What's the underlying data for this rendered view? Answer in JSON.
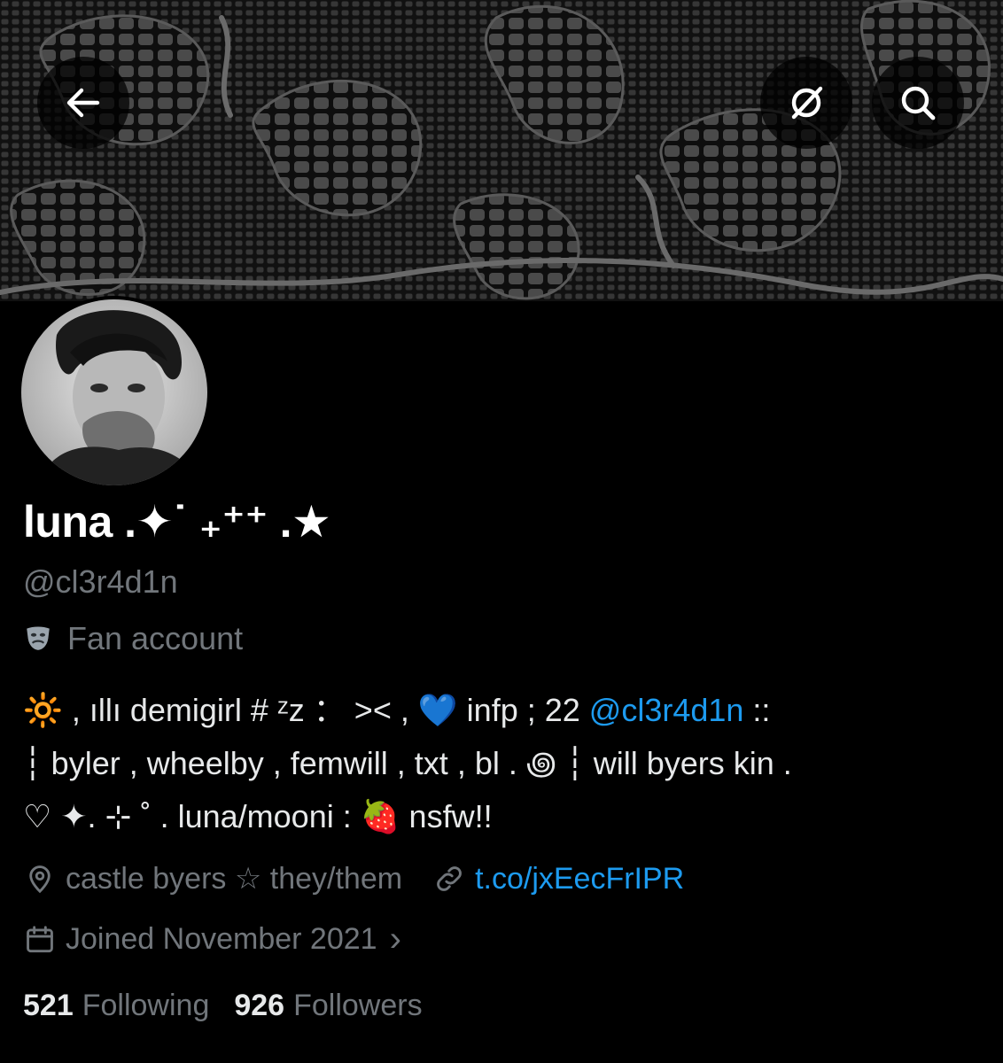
{
  "header": {
    "back_icon": "arrow-left-icon",
    "lens_icon": "grok-lens-icon",
    "search_icon": "search-icon"
  },
  "profile": {
    "name": "luna .✦˙ ₊⁺⁺ .★",
    "handle": "@cl3r4d1n",
    "category_icon": "theater-mask-icon",
    "category": "Fan account"
  },
  "bio": {
    "line1_pre": "🔆  , ıllı demigirl # ᶻz ： ><  , 💙 infp ; 22 ",
    "line1_mention": "@cl3r4d1n",
    "line1_post": " ::",
    "line2": "┆ byler , wheelby , femwill , txt , bl  .  ꩜  ┆ will byers kin  .",
    "line3": "♡ ✦. ⊹ ˚ . luna/mooni : 🍓  nsfw!!"
  },
  "meta": {
    "location": "castle byers ☆ they/them",
    "link": "t.co/jxEecFrIPR",
    "joined": "Joined November 2021",
    "joined_chevron": "›"
  },
  "stats": {
    "following_count": "521",
    "following_label": "Following",
    "followers_count": "926",
    "followers_label": "Followers"
  },
  "colors": {
    "background": "#000000",
    "primary_text": "#e7e9ea",
    "secondary_text": "#71767b",
    "link": "#1d9bf0"
  }
}
